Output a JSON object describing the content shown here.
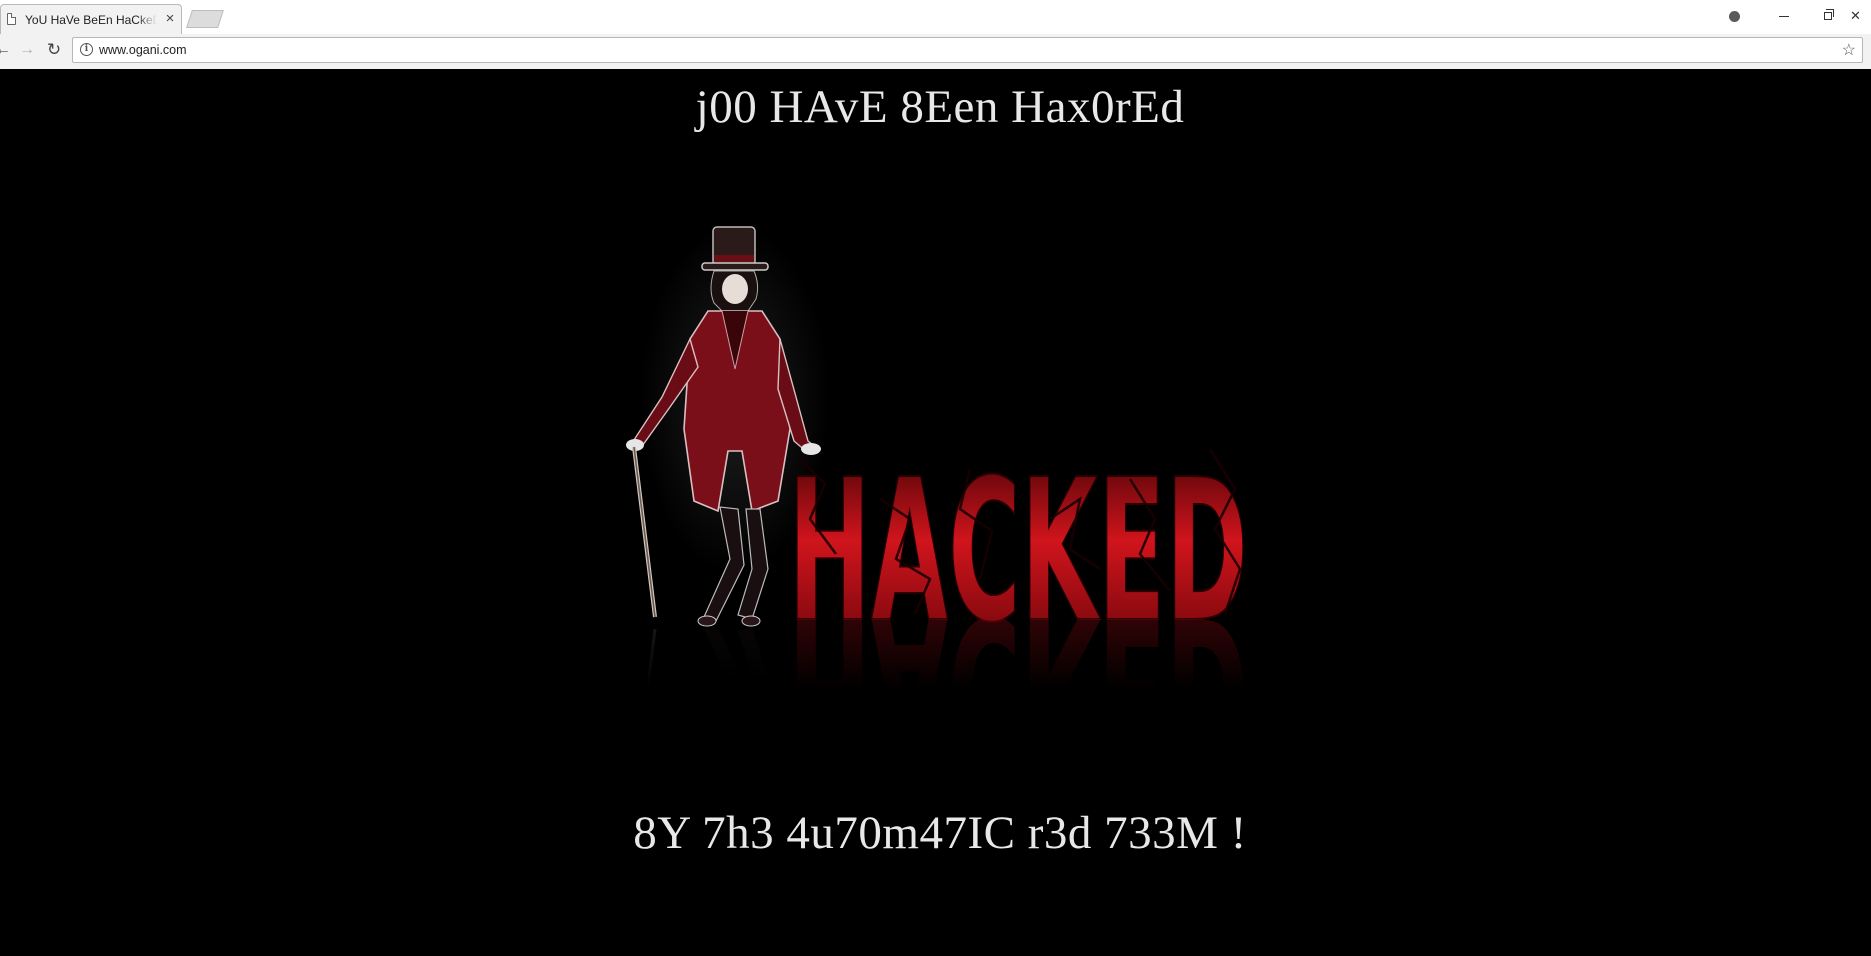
{
  "browser": {
    "tab": {
      "title": "YoU HaVe BeEn HaCkeD !"
    },
    "url": "www.ogani.com",
    "icons": {
      "tab": "page-icon",
      "close_tab": "close-icon",
      "new_tab": "new-tab-icon",
      "profile": "profile-icon",
      "back": "back-arrow-icon",
      "forward": "forward-arrow-icon",
      "reload": "reload-icon",
      "site_info": "info-icon",
      "bookmark": "star-icon"
    },
    "glyphs": {
      "close_tab": "×",
      "back": "←",
      "forward": "→",
      "reload": "↻",
      "info": "i",
      "star": "☆",
      "close_window": "✕"
    }
  },
  "page": {
    "headline": "j00 HAvE 8Een Hax0rEd",
    "banner_word": "HACKED",
    "signature": "8Y 7h3 4u70m47IC r3d 733M !",
    "colors": {
      "background": "#000000",
      "text": "#e8e8e8",
      "banner_red": "#c4161c",
      "banner_dark_red": "#5a0508",
      "coat_red": "#7a0f1a"
    }
  }
}
